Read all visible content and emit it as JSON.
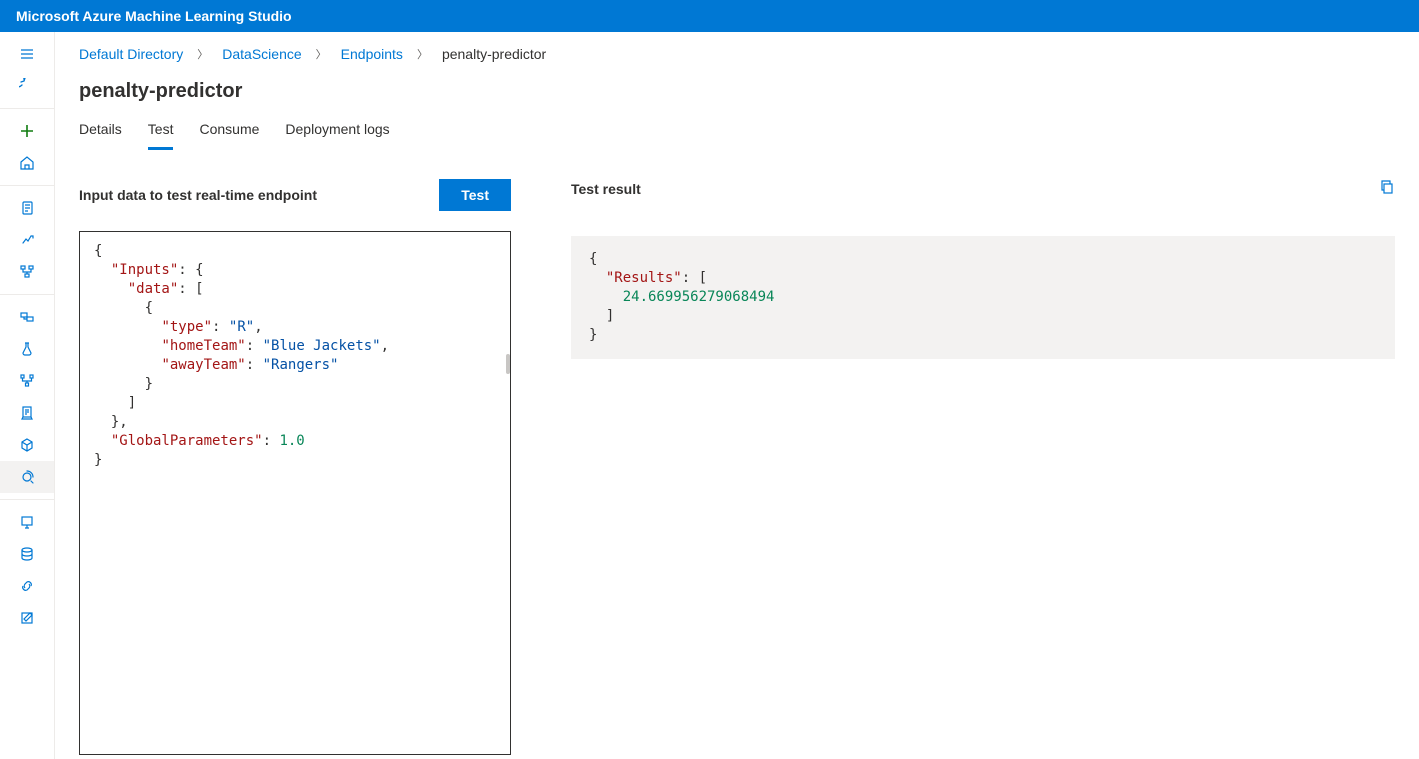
{
  "app_title": "Microsoft Azure Machine Learning Studio",
  "breadcrumb": {
    "items": [
      {
        "label": "Default Directory",
        "link": true
      },
      {
        "label": "DataScience",
        "link": true
      },
      {
        "label": "Endpoints",
        "link": true
      },
      {
        "label": "penalty-predictor",
        "link": false
      }
    ]
  },
  "page_title": "penalty-predictor",
  "tabs": [
    {
      "label": "Details",
      "active": false
    },
    {
      "label": "Test",
      "active": true
    },
    {
      "label": "Consume",
      "active": false
    },
    {
      "label": "Deployment logs",
      "active": false
    }
  ],
  "input_section": {
    "label": "Input data to test real-time endpoint",
    "button_label": "Test",
    "json": {
      "Inputs": {
        "data": [
          {
            "type": "R",
            "homeTeam": "Blue Jackets",
            "awayTeam": "Rangers"
          }
        ]
      },
      "GlobalParameters": 1.0
    }
  },
  "result_section": {
    "label": "Test result",
    "json": {
      "Results": [
        24.669956279068494
      ]
    }
  },
  "colors": {
    "primary": "#0078d4",
    "add_green": "#107c10",
    "json_key": "#a31515",
    "json_string": "#0451a5",
    "json_number": "#098658"
  }
}
